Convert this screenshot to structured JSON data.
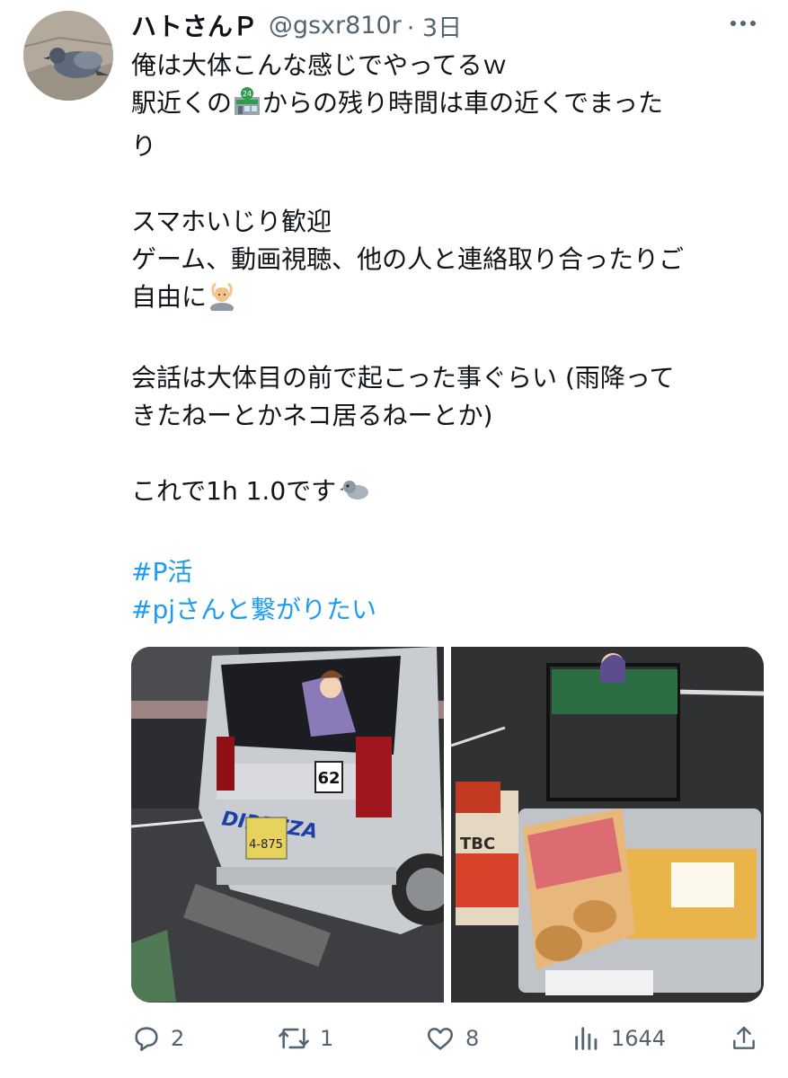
{
  "tweet": {
    "author": {
      "name": "ハトさんＰ",
      "handle": "@gsxr810r",
      "time": "· 3日"
    },
    "lines": [
      "俺は大体こんな感じでやってるｗ",
      "駅近くの",
      "からの残り時間は車の近くでまった",
      "り",
      "",
      "スマホいじり歓迎",
      "ゲーム、動画視聴、他の人と連絡取り合ったりご",
      "自由に",
      "",
      "会話は大体目の前で起こった事ぐらい (雨降って",
      "きたねーとかネコ居るねーとか)",
      "",
      "これで1h 1.0です",
      ""
    ],
    "hashtags": [
      "#P活",
      "#pjさんと繋がりたい"
    ],
    "photo_text": {
      "car_brand": "DIREZZA",
      "car_number": "62",
      "plate": "4-875",
      "juice_label": "TBC"
    },
    "stats": {
      "replies": "2",
      "retweets": "1",
      "likes": "8",
      "views": "1644"
    }
  },
  "icons": {
    "more": "more-icon",
    "reply": "reply-icon",
    "retweet": "retweet-icon",
    "like": "heart-icon",
    "views": "views-icon",
    "share": "share-icon"
  },
  "colors": {
    "text": "#0f1419",
    "muted": "#536471",
    "link": "#1d9bf0"
  }
}
